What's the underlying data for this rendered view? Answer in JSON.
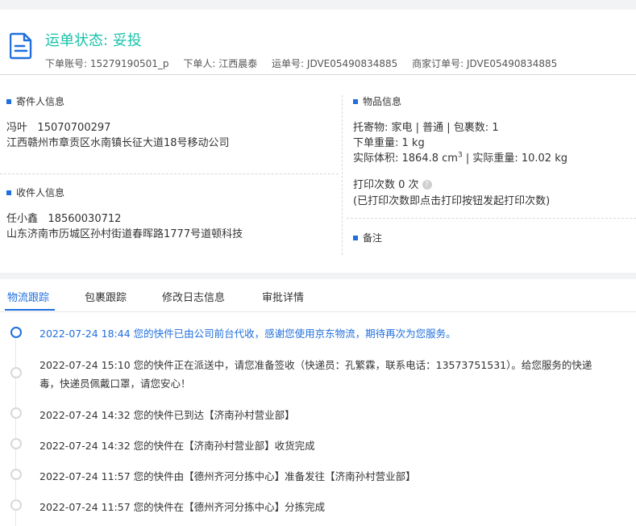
{
  "header": {
    "status_label": "运单状态: 妥投",
    "order_account_label": "下单账号:",
    "order_account": "15279190501_p",
    "orderer_label": "下单人:",
    "orderer": "江西晨泰",
    "waybill_label": "运单号:",
    "waybill": "JDVE05490834885",
    "merchant_order_label": "商家订单号:",
    "merchant_order": "JDVE05490834885"
  },
  "sender": {
    "title": "寄件人信息",
    "name": "冯叶",
    "phone": "15070700297",
    "address": "江西赣州市章贡区水南镇长征大道18号移动公司"
  },
  "receiver": {
    "title": "收件人信息",
    "name": "任小鑫",
    "phone": "18560030712",
    "address": "山东济南市历城区孙村街道春晖路1777号道顿科技"
  },
  "goods": {
    "title": "物品信息",
    "line1": "托寄物:  家电 | 普通  |  包裹数:   1",
    "line2": "下单重量:   1 kg",
    "line3_prefix": "实际体积:    1864.8 cm",
    "line3_sup": "3",
    "line3_suffix": " | 实际重量:   10.02 kg",
    "print_line": "打印次数    0 次",
    "print_note": "(已打印次数即点击打印按钮发起打印次数)",
    "remark_title": "备注"
  },
  "tabs": [
    "物流跟踪",
    "包裹跟踪",
    "修改日志信息",
    "审批详情"
  ],
  "timeline": [
    "2022-07-24 18:44  您的快件已由公司前台代收，感谢您使用京东物流，期待再次为您服务。",
    "2022-07-24 15:10  您的快件正在派送中，请您准备签收（快递员：孔繁霖，联系电话：13573751531）。给您服务的快递",
    "毒，快递员佩戴口罩，请您安心！",
    "2022-07-24 14:32  您的快件已到达【济南孙村营业部】",
    "2022-07-24 14:32  您的快件在【济南孙村营业部】收货完成",
    "2022-07-24 11:57  您的快件由【德州齐河分拣中心】准备发往【济南孙村营业部】",
    "2022-07-24 11:57  您的快件在【德州齐河分拣中心】分拣完成"
  ],
  "colors": {
    "accent": "#1f6fde",
    "status": "#19c2a9"
  }
}
